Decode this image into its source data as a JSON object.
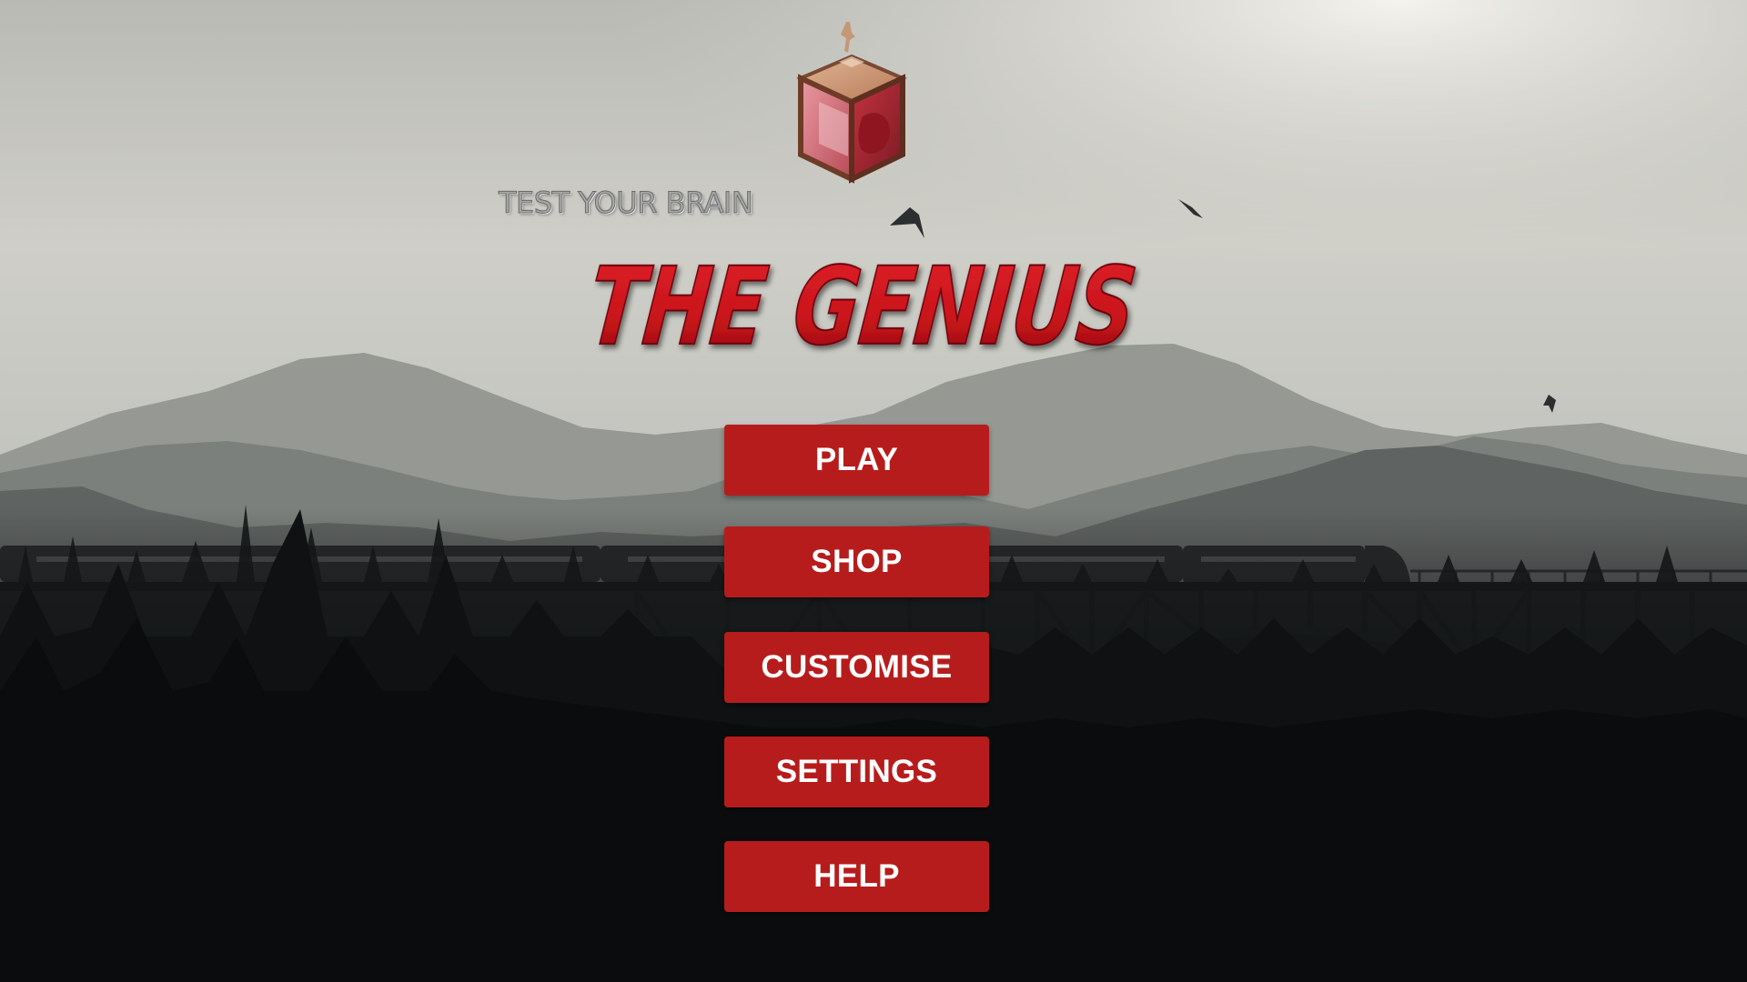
{
  "game": {
    "tagline": "TEST YOUR BRAIN",
    "title": "THE GENIUS",
    "logo_icon": "cube-brain-icon"
  },
  "menu": {
    "play_label": "PLAY",
    "shop_label": "SHOP",
    "customise_label": "CUSTOMISE",
    "settings_label": "SETTINGS",
    "help_label": "HELP"
  },
  "colors": {
    "button_red": "#b71c1c",
    "title_red": "#c8141a",
    "button_text": "#ffffff"
  }
}
